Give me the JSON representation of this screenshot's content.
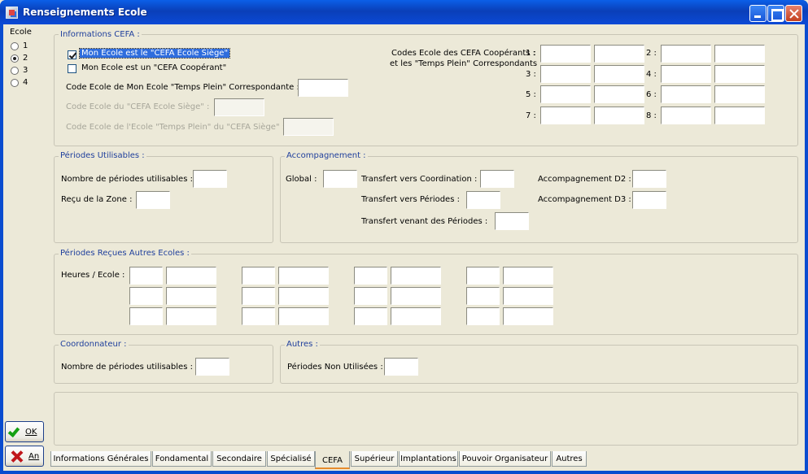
{
  "window": {
    "title": "Renseignements Ecole"
  },
  "ecole": {
    "label": "Ecole",
    "options": [
      "1",
      "2",
      "3",
      "4"
    ],
    "selected": "2"
  },
  "cefa": {
    "group_title": "Informations CEFA :",
    "siege_label": "Mon Ecole est le \"CEFA Ecole Siège\"",
    "siege_checked": true,
    "cooperant_label": "Mon Ecole est un \"CEFA Coopérant\"",
    "cooperant_checked": false,
    "code_temps_plein_label": "Code Ecole de Mon Ecole \"Temps Plein\" Correspondante :",
    "code_siege_label": "Code Ecole du \"CEFA Ecole Siège\" :",
    "code_tp_siege_label": "Code Ecole de l'Ecole \"Temps Plein\" du \"CEFA Siège\" :",
    "codes_coop_label_1": "Codes Ecole des CEFA Coopérants :",
    "codes_coop_label_2": "et les \"Temps Plein\" Correspondants",
    "slot_labels": [
      "1 :",
      "2 :",
      "3 :",
      "4 :",
      "5 :",
      "6 :",
      "7 :",
      "8 :"
    ]
  },
  "periodes": {
    "group_title": "Périodes Utilisables :",
    "nombre_label": "Nombre de périodes utilisables  :",
    "recu_label": "Reçu de la Zone :"
  },
  "accompagnement": {
    "group_title": "Accompagnement :",
    "global_label": "Global :",
    "coord_label": "Transfert vers Coordination :",
    "periodes_label": "Transfert vers Périodes :",
    "venant_label": "Transfert venant des  Périodes :",
    "d2_label": "Accompagnement D2 :",
    "d3_label": "Accompagnement D3 :"
  },
  "autres_ecoles": {
    "group_title": "Périodes Reçues Autres Ecoles :",
    "heures_label": "Heures / Ecole :"
  },
  "coordonnateur": {
    "group_title": "Coordonnateur :",
    "nombre_label": "Nombre de périodes utilisables  :"
  },
  "autres": {
    "group_title": "Autres :",
    "non_utilisees_label": "Périodes Non Utilisées :"
  },
  "buttons": {
    "ok": "OK",
    "annuler": "An"
  },
  "tabs": [
    "Informations Générales",
    "Fondamental",
    "Secondaire",
    "Spécialisé",
    "CEFA",
    "Supérieur",
    "Implantations",
    "Pouvoir Organisateur",
    "Autres"
  ],
  "active_tab": "CEFA"
}
